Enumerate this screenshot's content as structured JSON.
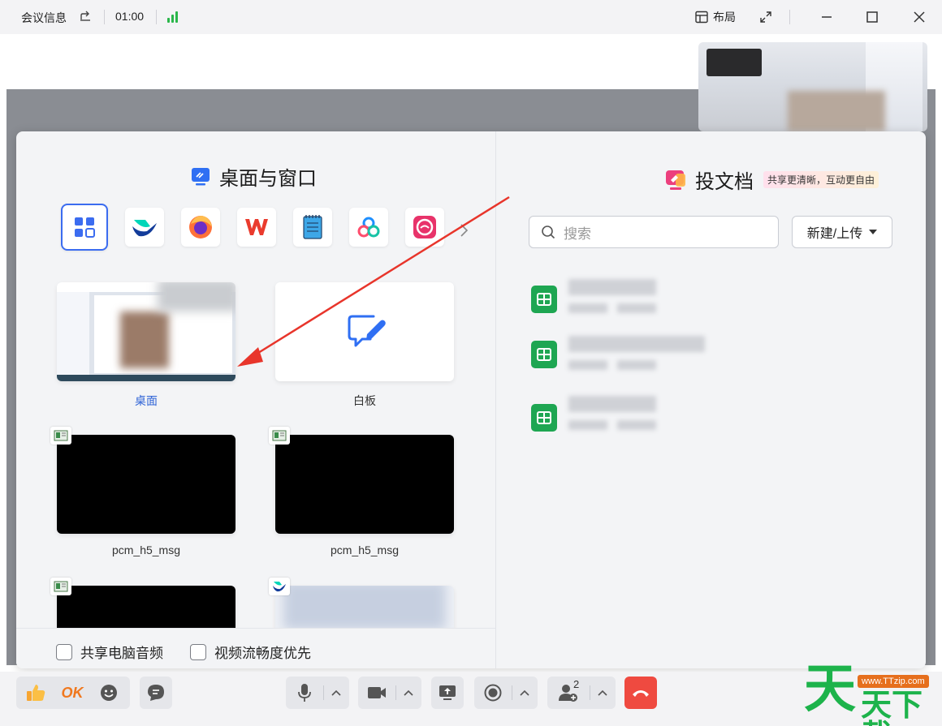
{
  "titlebar": {
    "title": "会议信息",
    "time": "01:00",
    "layout_label": "布局"
  },
  "panel": {
    "left_title": "桌面与窗口",
    "right_title": "投文档",
    "right_tag": "共享更清晰，互动更自由",
    "tiles": [
      {
        "label": "桌面",
        "kind": "desktop",
        "selected": true
      },
      {
        "label": "白板",
        "kind": "whiteboard",
        "selected": false
      },
      {
        "label": "pcm_h5_msg",
        "kind": "window",
        "selected": false
      },
      {
        "label": "pcm_h5_msg",
        "kind": "window",
        "selected": false
      },
      {
        "label": "",
        "kind": "window",
        "selected": false
      },
      {
        "label": "",
        "kind": "window",
        "selected": false
      }
    ],
    "app_icons": [
      "grid-icon",
      "feishu-icon",
      "firefox-icon",
      "wps-icon",
      "notepad-icon",
      "tencent-docs-icon",
      "screen-record-icon"
    ],
    "options": {
      "share_audio": "共享电脑音频",
      "video_smooth": "视频流畅度优先"
    },
    "search": {
      "placeholder": "搜索"
    },
    "new_upload": "新建/上传"
  },
  "toolbar": {
    "ok_label": "OK",
    "participants_count": "2"
  },
  "watermark": {
    "site": "www.TTzip.com",
    "text1": "天",
    "text2": "天下載"
  },
  "colors": {
    "accent": "#3b6cf0",
    "hangup": "#ef4a40",
    "sheet_green": "#1ea652",
    "arrow": "#e8352b",
    "signal": "#2ab64a"
  }
}
